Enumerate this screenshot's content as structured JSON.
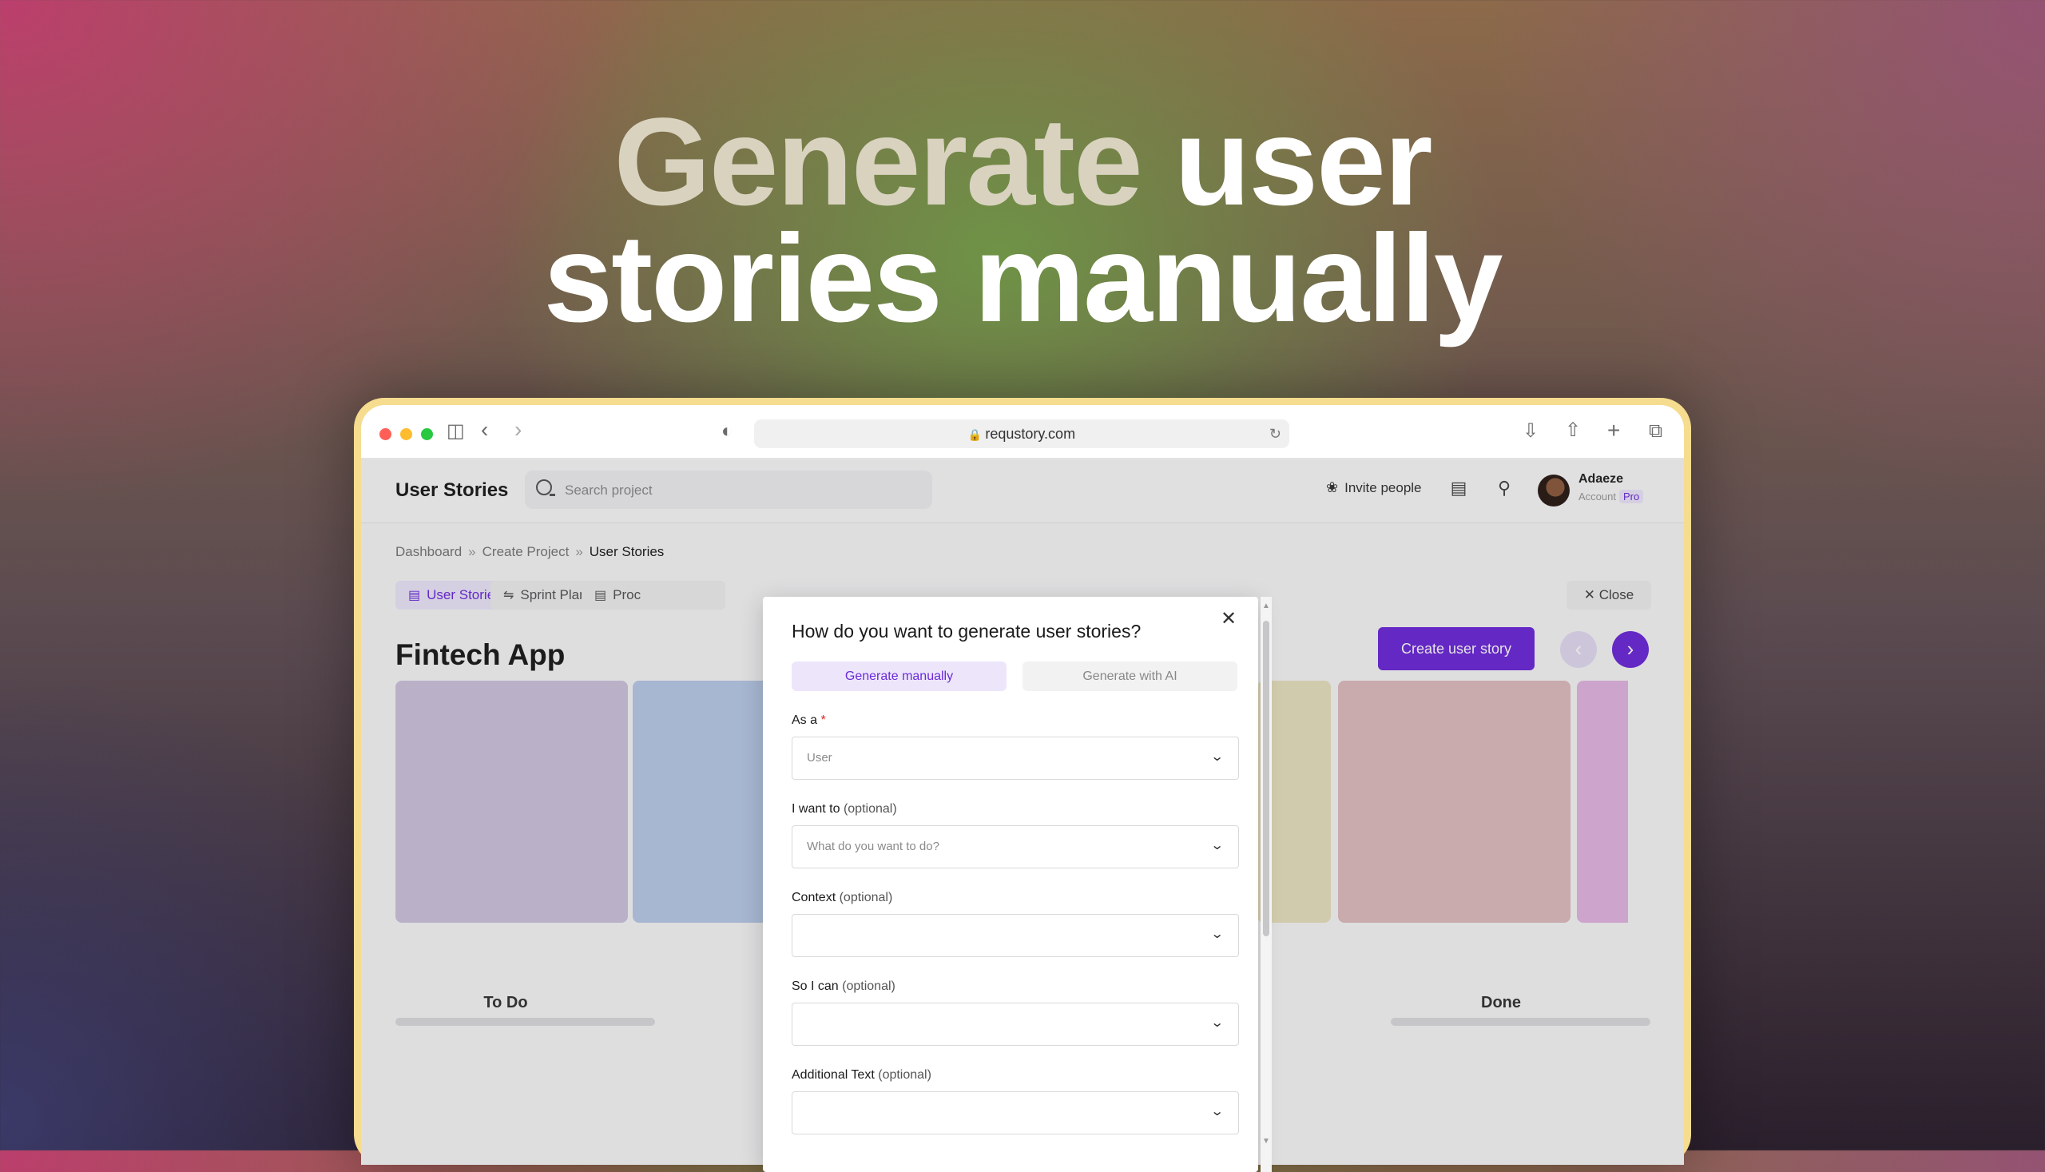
{
  "headline": {
    "light": "Generate",
    "rest_line1": "user",
    "line2": "stories manually"
  },
  "browser": {
    "url": "requstory.com"
  },
  "app": {
    "title": "User Stories",
    "search_placeholder": "Search project",
    "invite_label": "Invite people",
    "user": {
      "name": "Adaeze",
      "sub": "Account",
      "badge": "Pro"
    }
  },
  "breadcrumb": [
    "Dashboard",
    "Create Project",
    "User Stories"
  ],
  "tabs": [
    "User Stories",
    "Sprint Planning",
    "Proc"
  ],
  "close_label": "Close",
  "project_title": "Fintech App",
  "create_button": "Create user story",
  "columns": [
    {
      "label": "To Do",
      "color": "#cec4df"
    },
    {
      "label": "",
      "color": "#b9cae7"
    },
    {
      "label": "",
      "color": "#e9e2bf"
    },
    {
      "label": "Done",
      "color": "#e0bcbf"
    },
    {
      "label": "",
      "color": "#e4b7e2"
    }
  ],
  "modal": {
    "title": "How do you want to generate user stories?",
    "tab_manual": "Generate manually",
    "tab_ai": "Generate with AI",
    "fields": [
      {
        "label": "As a",
        "suffix": "*",
        "value": "User"
      },
      {
        "label": "I want to",
        "suffix": "(optional)",
        "value": "What do you want to do?"
      },
      {
        "label": "Context",
        "suffix": "(optional)",
        "value": ""
      },
      {
        "label": "So I can",
        "suffix": "(optional)",
        "value": ""
      },
      {
        "label": "Additional Text",
        "suffix": "(optional)",
        "value": ""
      }
    ]
  },
  "colors": {
    "accent": "#6d28d9",
    "frame": "#f6dc8e"
  }
}
